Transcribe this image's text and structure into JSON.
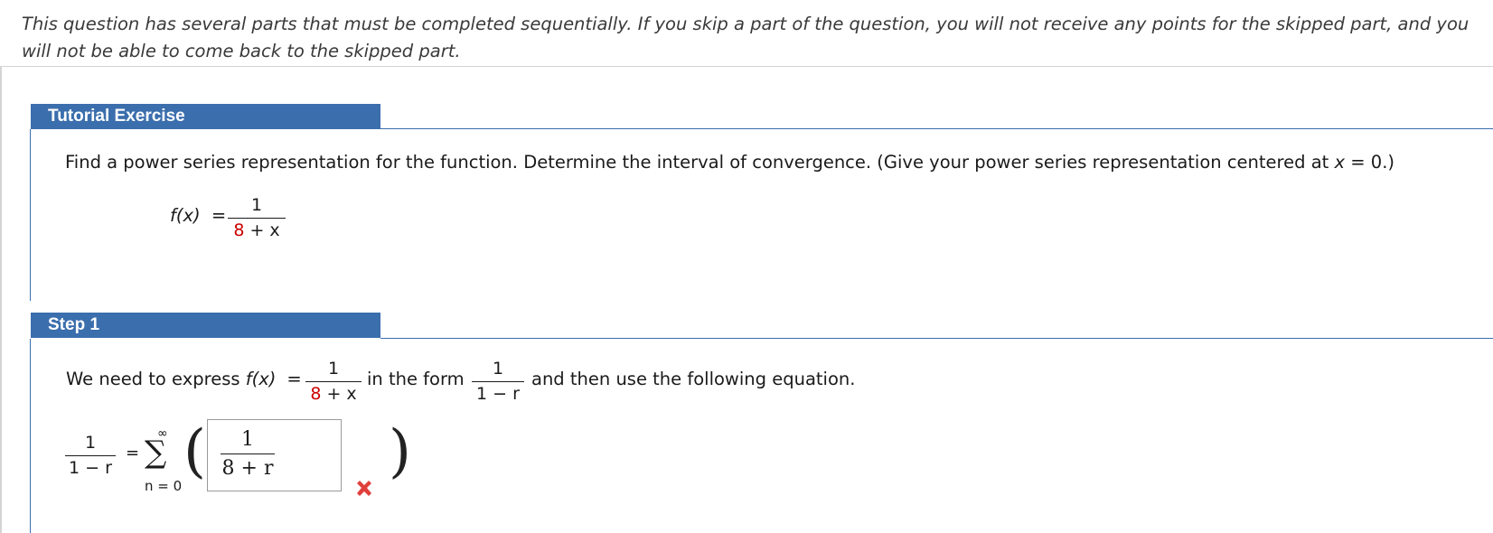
{
  "notice": {
    "text": "This question has several parts that must be completed sequentially. If you skip a part of the question, you will not receive any points for the skipped part, and you will not be able to come back to the skipped part."
  },
  "tutorial": {
    "header": "Tutorial Exercise",
    "prompt_before": "Find a power series representation for the function. Determine the interval of convergence. (Give your power series representation centered at ",
    "prompt_var": "x",
    "prompt_after": " = 0.)",
    "function": {
      "lhs": "f(x)",
      "eq": "=",
      "numerator": "1",
      "denominator_const": "8",
      "denominator_rest": " + x"
    }
  },
  "step1": {
    "header": "Step 1",
    "text_before": "We need to express ",
    "fx": "f(x)",
    "eq": "=",
    "frac1": {
      "numerator": "1",
      "denominator_const": "8",
      "denominator_rest": " + x"
    },
    "text_middle": "in the form",
    "frac2": {
      "numerator": "1",
      "denominator": "1 − r"
    },
    "text_after": "and then use the following equation.",
    "equation": {
      "lhs_numerator": "1",
      "lhs_denominator": "1 − r",
      "eq": "=",
      "sigma": "∑",
      "sigma_top": "∞",
      "sigma_bottom": "n = 0",
      "answer_numerator": "1",
      "answer_denominator": "8 + r",
      "status_icon": "x-mark-icon",
      "status_color": "#e0403c"
    }
  },
  "colors": {
    "header_bg": "#3b6ead",
    "highlight_red": "#cc0000"
  }
}
